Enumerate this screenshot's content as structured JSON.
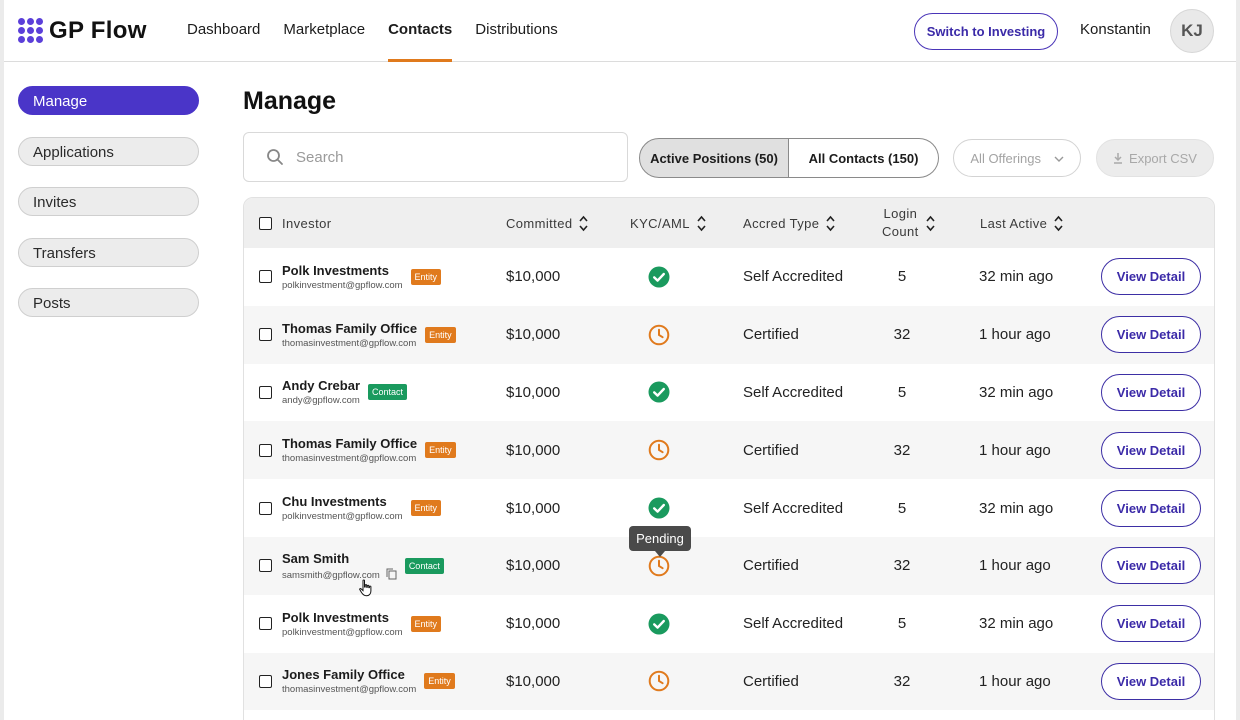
{
  "app": {
    "name": "GP Flow"
  },
  "nav": {
    "items": [
      {
        "label": "Dashboard",
        "active": false
      },
      {
        "label": "Marketplace",
        "active": false
      },
      {
        "label": "Contacts",
        "active": true
      },
      {
        "label": "Distributions",
        "active": false
      }
    ],
    "accent": "#e07a1d"
  },
  "header": {
    "switch_label": "Switch to Investing",
    "user_name": "Konstantin",
    "avatar_initials": "KJ"
  },
  "sidebar": {
    "items": [
      {
        "label": "Manage",
        "active": true
      },
      {
        "label": "Applications",
        "active": false
      },
      {
        "label": "Invites",
        "active": false
      },
      {
        "label": "Transfers",
        "active": false
      },
      {
        "label": "Posts",
        "active": false
      }
    ]
  },
  "main": {
    "title": "Manage",
    "search_placeholder": "Search",
    "segments": {
      "active_positions": "Active Positions  (50)",
      "all_contacts": "All Contacts (150)"
    },
    "offerings_label": "All Offerings",
    "export_label": "Export CSV"
  },
  "table": {
    "headers": {
      "investor": "Investor",
      "committed": "Committed",
      "kyc": "KYC/AML",
      "accred": "Accred Type",
      "login_1": "Login",
      "login_2": "Count",
      "last_active": "Last Active"
    },
    "view_label": "View Detail",
    "rows": [
      {
        "name": "Polk Investments",
        "email": "polkinvestment@gpflow.com",
        "badge": "Entity",
        "committed": "$10,000",
        "kyc": "verified",
        "accred": "Self Accredited",
        "logins": "5",
        "last_active": "32 min ago"
      },
      {
        "name": "Thomas Family Office",
        "email": "thomasinvestment@gpflow.com",
        "badge": "Entity",
        "committed": "$10,000",
        "kyc": "pending",
        "accred": "Certified",
        "logins": "32",
        "last_active": "1 hour ago"
      },
      {
        "name": "Andy Crebar",
        "email": "andy@gpflow.com",
        "badge": "Contact",
        "committed": "$10,000",
        "kyc": "verified",
        "accred": "Self Accredited",
        "logins": "5",
        "last_active": "32 min ago"
      },
      {
        "name": "Thomas Family Office",
        "email": "thomasinvestment@gpflow.com",
        "badge": "Entity",
        "committed": "$10,000",
        "kyc": "pending",
        "accred": "Certified",
        "logins": "32",
        "last_active": "1 hour ago"
      },
      {
        "name": "Chu Investments",
        "email": "polkinvestment@gpflow.com",
        "badge": "Entity",
        "committed": "$10,000",
        "kyc": "verified",
        "accred": "Self Accredited",
        "logins": "5",
        "last_active": "32 min ago"
      },
      {
        "name": "Sam Smith",
        "email": "samsmith@gpflow.com",
        "badge": "Contact",
        "committed": "$10,000",
        "kyc": "pending",
        "accred": "Certified",
        "logins": "32",
        "last_active": "1 hour ago"
      },
      {
        "name": "Polk Investments",
        "email": "polkinvestment@gpflow.com",
        "badge": "Entity",
        "committed": "$10,000",
        "kyc": "verified",
        "accred": "Self Accredited",
        "logins": "5",
        "last_active": "32 min ago"
      },
      {
        "name": "Jones Family Office",
        "email": "thomasinvestment@gpflow.com",
        "badge": "Entity",
        "committed": "$10,000",
        "kyc": "pending",
        "accred": "Certified",
        "logins": "32",
        "last_active": "1 hour ago"
      }
    ]
  },
  "tooltip": {
    "text": "Pending"
  },
  "colors": {
    "brand": "#4a35c8",
    "entity_badge": "#e07a1d",
    "contact_badge": "#1a9a5e",
    "kyc_verified": "#1a9a5e",
    "kyc_pending": "#e07a1d"
  }
}
